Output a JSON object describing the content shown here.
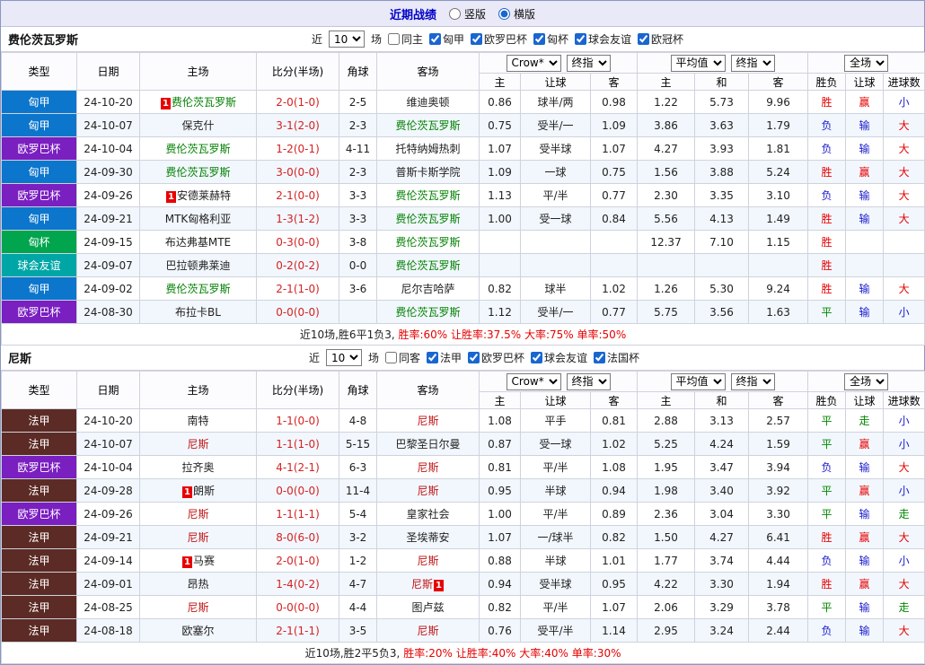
{
  "topbar": {
    "title": "近期战绩",
    "vertical_label": "竖版",
    "horizontal_label": "横版"
  },
  "selects": {
    "odds_company": "Crow*",
    "odds_time": "终指",
    "euro_source": "平均值",
    "euro_time": "终指",
    "scope": "全场"
  },
  "table_header": {
    "main": [
      "类型",
      "日期",
      "主场",
      "比分(半场)",
      "角球",
      "客场"
    ],
    "sub": [
      "主",
      "让球",
      "客",
      "主",
      "和",
      "客",
      "胜负",
      "让球",
      "进球数"
    ]
  },
  "mark_label": "1",
  "league_colors": {
    "匈甲": "#0b76cc",
    "欧罗巴杯": "#7a1fc0",
    "匈杯": "#00a54e",
    "球会友谊": "#00a6a6",
    "法甲": "#5c2b25"
  },
  "team_colors": {
    "费伦茨瓦罗斯": "#008000",
    "尼斯": "#c01515"
  },
  "result_colors": {
    "胜": "#e60000",
    "赢": "#e60000",
    "大": "#e60000",
    "负": "#1a1acd",
    "输": "#1a1acd",
    "小": "#1a1acd",
    "平": "#008800",
    "走": "#008800"
  },
  "sections": [
    {
      "team": "费伦茨瓦罗斯",
      "filter": {
        "near": "近",
        "count": "10",
        "games": "场",
        "same": "同主",
        "leagues": [
          "匈甲",
          "欧罗巴杯",
          "匈杯",
          "球会友谊",
          "欧冠杯"
        ]
      },
      "rows": [
        {
          "lg": "匈甲",
          "dt": "24-10-20",
          "hm": "费伦茨瓦罗斯",
          "hmk": "b",
          "sc": "2-0(1-0)",
          "cn": "2-5",
          "aw": "维迪奥顿",
          "o": [
            "0.86",
            "球半/两",
            "0.98"
          ],
          "e": [
            "1.22",
            "5.73",
            "9.96"
          ],
          "res": [
            "胜",
            "赢",
            "小"
          ]
        },
        {
          "lg": "匈甲",
          "dt": "24-10-07",
          "hm": "保克什",
          "sc": "3-1(2-0)",
          "cn": "2-3",
          "aw": "费伦茨瓦罗斯",
          "o": [
            "0.75",
            "受半/一",
            "1.09"
          ],
          "e": [
            "3.86",
            "3.63",
            "1.79"
          ],
          "res": [
            "负",
            "输",
            "大"
          ]
        },
        {
          "lg": "欧罗巴杯",
          "dt": "24-10-04",
          "hm": "费伦茨瓦罗斯",
          "sc": "1-2(0-1)",
          "cn": "4-11",
          "aw": "托特纳姆热刺",
          "o": [
            "1.07",
            "受半球",
            "1.07"
          ],
          "e": [
            "4.27",
            "3.93",
            "1.81"
          ],
          "res": [
            "负",
            "输",
            "大"
          ]
        },
        {
          "lg": "匈甲",
          "dt": "24-09-30",
          "hm": "费伦茨瓦罗斯",
          "sc": "3-0(0-0)",
          "cn": "2-3",
          "aw": "普斯卡斯学院",
          "o": [
            "1.09",
            "一球",
            "0.75"
          ],
          "e": [
            "1.56",
            "3.88",
            "5.24"
          ],
          "res": [
            "胜",
            "赢",
            "大"
          ]
        },
        {
          "lg": "欧罗巴杯",
          "dt": "24-09-26",
          "hm": "安德莱赫特",
          "hmk": "b",
          "sc": "2-1(0-0)",
          "cn": "3-3",
          "aw": "费伦茨瓦罗斯",
          "o": [
            "1.13",
            "平/半",
            "0.77"
          ],
          "e": [
            "2.30",
            "3.35",
            "3.10"
          ],
          "res": [
            "负",
            "输",
            "大"
          ]
        },
        {
          "lg": "匈甲",
          "dt": "24-09-21",
          "hm": "MTK匈格利亚",
          "sc": "1-3(1-2)",
          "cn": "3-3",
          "aw": "费伦茨瓦罗斯",
          "o": [
            "1.00",
            "受一球",
            "0.84"
          ],
          "e": [
            "5.56",
            "4.13",
            "1.49"
          ],
          "res": [
            "胜",
            "输",
            "大"
          ]
        },
        {
          "lg": "匈杯",
          "dt": "24-09-15",
          "hm": "布达弗基MTE",
          "sc": "0-3(0-0)",
          "cn": "3-8",
          "aw": "费伦茨瓦罗斯",
          "o": [
            "",
            "",
            ""
          ],
          "e": [
            "12.37",
            "7.10",
            "1.15"
          ],
          "res": [
            "胜",
            "",
            ""
          ]
        },
        {
          "lg": "球会友谊",
          "dt": "24-09-07",
          "hm": "巴拉顿弗莱迪",
          "sc": "0-2(0-2)",
          "cn": "0-0",
          "aw": "费伦茨瓦罗斯",
          "o": [
            "",
            "",
            ""
          ],
          "e": [
            "",
            "",
            ""
          ],
          "res": [
            "胜",
            "",
            ""
          ]
        },
        {
          "lg": "匈甲",
          "dt": "24-09-02",
          "hm": "费伦茨瓦罗斯",
          "sc": "2-1(1-0)",
          "cn": "3-6",
          "aw": "尼尔吉哈萨",
          "o": [
            "0.82",
            "球半",
            "1.02"
          ],
          "e": [
            "1.26",
            "5.30",
            "9.24"
          ],
          "res": [
            "胜",
            "输",
            "大"
          ]
        },
        {
          "lg": "欧罗巴杯",
          "dt": "24-08-30",
          "hm": "布拉卡BL",
          "sc": "0-0(0-0)",
          "cn": "",
          "aw": "费伦茨瓦罗斯",
          "o": [
            "1.12",
            "受半/一",
            "0.77"
          ],
          "e": [
            "5.75",
            "3.56",
            "1.63"
          ],
          "res": [
            "平",
            "输",
            "小"
          ]
        }
      ],
      "summary": [
        {
          "text": "近10场,胜6平1负3, ",
          "color": "#222222"
        },
        {
          "text": "胜率:60% 让胜率:37.5% 大率:75% 单率:50%",
          "color": "#e60000"
        }
      ]
    },
    {
      "team": "尼斯",
      "filter": {
        "near": "近",
        "count": "10",
        "games": "场",
        "same": "同客",
        "leagues": [
          "法甲",
          "欧罗巴杯",
          "球会友谊",
          "法国杯"
        ]
      },
      "rows": [
        {
          "lg": "法甲",
          "dt": "24-10-20",
          "hm": "南特",
          "sc": "1-1(0-0)",
          "cn": "4-8",
          "aw": "尼斯",
          "o": [
            "1.08",
            "平手",
            "0.81"
          ],
          "e": [
            "2.88",
            "3.13",
            "2.57"
          ],
          "res": [
            "平",
            "走",
            "小"
          ]
        },
        {
          "lg": "法甲",
          "dt": "24-10-07",
          "hm": "尼斯",
          "sc": "1-1(1-0)",
          "cn": "5-15",
          "aw": "巴黎圣日尔曼",
          "o": [
            "0.87",
            "受一球",
            "1.02"
          ],
          "e": [
            "5.25",
            "4.24",
            "1.59"
          ],
          "res": [
            "平",
            "赢",
            "小"
          ]
        },
        {
          "lg": "欧罗巴杯",
          "dt": "24-10-04",
          "hm": "拉齐奥",
          "sc": "4-1(2-1)",
          "cn": "6-3",
          "aw": "尼斯",
          "o": [
            "0.81",
            "平/半",
            "1.08"
          ],
          "e": [
            "1.95",
            "3.47",
            "3.94"
          ],
          "res": [
            "负",
            "输",
            "大"
          ]
        },
        {
          "lg": "法甲",
          "dt": "24-09-28",
          "hm": "朗斯",
          "hmk": "b",
          "sc": "0-0(0-0)",
          "cn": "11-4",
          "aw": "尼斯",
          "o": [
            "0.95",
            "半球",
            "0.94"
          ],
          "e": [
            "1.98",
            "3.40",
            "3.92"
          ],
          "res": [
            "平",
            "赢",
            "小"
          ]
        },
        {
          "lg": "欧罗巴杯",
          "dt": "24-09-26",
          "hm": "尼斯",
          "sc": "1-1(1-1)",
          "cn": "5-4",
          "aw": "皇家社会",
          "o": [
            "1.00",
            "平/半",
            "0.89"
          ],
          "e": [
            "2.36",
            "3.04",
            "3.30"
          ],
          "res": [
            "平",
            "输",
            "走"
          ]
        },
        {
          "lg": "法甲",
          "dt": "24-09-21",
          "hm": "尼斯",
          "sc": "8-0(6-0)",
          "cn": "3-2",
          "aw": "圣埃蒂安",
          "o": [
            "1.07",
            "一/球半",
            "0.82"
          ],
          "e": [
            "1.50",
            "4.27",
            "6.41"
          ],
          "res": [
            "胜",
            "赢",
            "大"
          ]
        },
        {
          "lg": "法甲",
          "dt": "24-09-14",
          "hm": "马赛",
          "hmk": "b",
          "sc": "2-0(1-0)",
          "cn": "1-2",
          "aw": "尼斯",
          "o": [
            "0.88",
            "半球",
            "1.01"
          ],
          "e": [
            "1.77",
            "3.74",
            "4.44"
          ],
          "res": [
            "负",
            "输",
            "小"
          ]
        },
        {
          "lg": "法甲",
          "dt": "24-09-01",
          "hm": "昂热",
          "sc": "1-4(0-2)",
          "cn": "4-7",
          "aw": "尼斯",
          "awk": "a",
          "o": [
            "0.94",
            "受半球",
            "0.95"
          ],
          "e": [
            "4.22",
            "3.30",
            "1.94"
          ],
          "res": [
            "胜",
            "赢",
            "大"
          ]
        },
        {
          "lg": "法甲",
          "dt": "24-08-25",
          "hm": "尼斯",
          "sc": "0-0(0-0)",
          "cn": "4-4",
          "aw": "图卢兹",
          "o": [
            "0.82",
            "平/半",
            "1.07"
          ],
          "e": [
            "2.06",
            "3.29",
            "3.78"
          ],
          "res": [
            "平",
            "输",
            "走"
          ]
        },
        {
          "lg": "法甲",
          "dt": "24-08-18",
          "hm": "欧塞尔",
          "sc": "2-1(1-1)",
          "cn": "3-5",
          "aw": "尼斯",
          "o": [
            "0.76",
            "受平/半",
            "1.14"
          ],
          "e": [
            "2.95",
            "3.24",
            "2.44"
          ],
          "res": [
            "负",
            "输",
            "大"
          ]
        }
      ],
      "summary": [
        {
          "text": "近10场,胜2平5负3, ",
          "color": "#222222"
        },
        {
          "text": "胜率:20% 让胜率:40% 大率:40% 单率:30%",
          "color": "#e60000"
        }
      ]
    }
  ]
}
